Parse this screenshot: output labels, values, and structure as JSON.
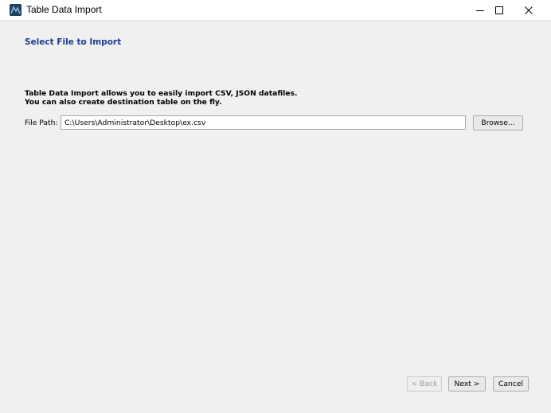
{
  "window": {
    "title": "Table Data Import",
    "icon": "mysql-workbench-icon",
    "controls": {
      "minimize": "minimize-icon",
      "maximize": "maximize-icon",
      "close": "close-icon"
    }
  },
  "page": {
    "heading": "Select File to Import",
    "description_line1": "Table Data Import allows you to easily import CSV, JSON datafiles.",
    "description_line2": "You can also create destination table on the fly."
  },
  "file_path": {
    "label": "File Path:",
    "value": "C:\\Users\\Administrator\\Desktop\\ex.csv",
    "browse_label": "Browse..."
  },
  "footer": {
    "back_label": "< Back",
    "back_enabled": false,
    "next_label": "Next >",
    "cancel_label": "Cancel"
  },
  "colors": {
    "heading": "#1d3e8c",
    "window_bg": "#f0f0f0",
    "titlebar_bg": "#ffffff"
  }
}
